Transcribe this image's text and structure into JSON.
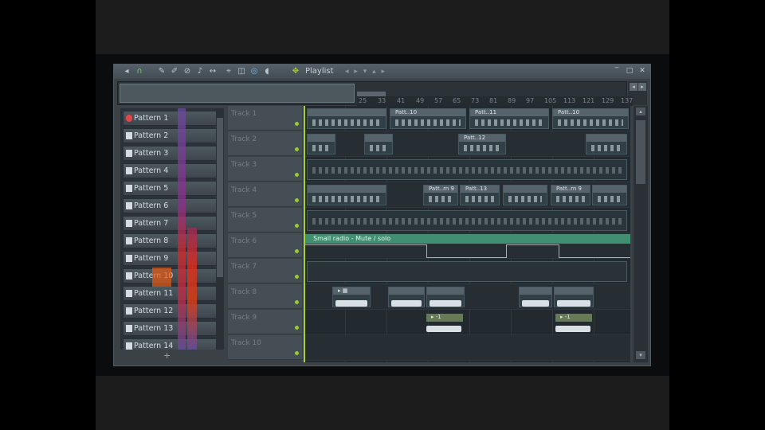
{
  "window": {
    "title": "Playlist",
    "title_arrows": "◂ ▸ ▾ ▴ ▸"
  },
  "toolbar": {
    "icons": [
      "arrow-left-icon",
      "loop-icon",
      "paint-icon",
      "draw-icon",
      "slice-icon",
      "mute-icon",
      "scroll-icon",
      "select-icon",
      "zoom-icon",
      "playback-icon",
      "speaker-icon",
      "playlist-icon"
    ]
  },
  "ruler": {
    "bars": [
      "25",
      "33",
      "41",
      "49",
      "57",
      "65",
      "73",
      "81",
      "89",
      "97",
      "105",
      "113",
      "121",
      "129",
      "137"
    ]
  },
  "patterns": [
    {
      "label": "Pattern 1",
      "selected": true
    },
    {
      "label": "Pattern 2",
      "selected": false
    },
    {
      "label": "Pattern 3",
      "selected": false
    },
    {
      "label": "Pattern 4",
      "selected": false
    },
    {
      "label": "Pattern 5",
      "selected": false
    },
    {
      "label": "Pattern 6",
      "selected": false
    },
    {
      "label": "Pattern 7",
      "selected": false
    },
    {
      "label": "Pattern 8",
      "selected": false
    },
    {
      "label": "Pattern 9",
      "selected": false
    },
    {
      "label": "Pattern 10",
      "selected": false
    },
    {
      "label": "Pattern 11",
      "selected": false
    },
    {
      "label": "Pattern 12",
      "selected": false
    },
    {
      "label": "Pattern 13",
      "selected": false
    },
    {
      "label": "Pattern 14",
      "selected": false
    }
  ],
  "add_pattern": "+",
  "tracks": [
    "Track 1",
    "Track 2",
    "Track 3",
    "Track 4",
    "Track 5",
    "Track 6",
    "Track 7",
    "Track 8",
    "Track 9",
    "Track 10"
  ],
  "clips": {
    "track1_a": "Patt..10",
    "track1_b": "Patt..11",
    "track1_c": "Patt..10",
    "track2_a": "Patt..12",
    "track4_a": "Patt..rn 9",
    "track4_b": "Patt..13",
    "track4_c": "Patt..rn 9",
    "track8_a": "▸ ▦",
    "track9_a": "▸ -1",
    "track9_b": "▸ -1"
  },
  "automation": {
    "label": "Small radio - Mute / solo"
  }
}
